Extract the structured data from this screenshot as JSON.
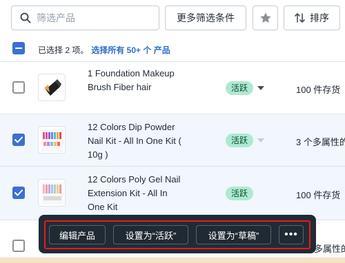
{
  "filters": {
    "search_placeholder": "筛选产品",
    "more_filters_label": "更多筛选条件",
    "sort_label": "排序"
  },
  "selection": {
    "count_text": "已选择 2 项。",
    "select_all_text": "选择所有 50+ 个 产品"
  },
  "products": [
    {
      "title": "1 Foundation Makeup Brush Fiber hair",
      "status": "活跃",
      "inventory": "100 件存货",
      "selected": false
    },
    {
      "title": "12 Colors Dip Powder Nail Kit - All In One Kit ( 10g )",
      "status": "活跃",
      "inventory": "3 个多属性的",
      "selected": true
    },
    {
      "title": "12 Colors Poly Gel Nail Extension Kit - All In One Kit",
      "status": "活跃",
      "inventory": "100 件存货",
      "selected": true
    },
    {
      "title": "",
      "status": "",
      "inventory": "多属性的",
      "selected": false
    }
  ],
  "bulk_actions": {
    "edit_label": "编辑产品",
    "set_active_label": "设置为“活跃”",
    "set_draft_label": "设置为“草稿”",
    "more_label": "•••"
  },
  "colors": {
    "accent_blue": "#3d6fd0",
    "link_blue": "#2c6ecb",
    "badge_green": "#aee9d1",
    "toolbar_dark": "#212b36",
    "highlight_red": "#e81b1b"
  }
}
